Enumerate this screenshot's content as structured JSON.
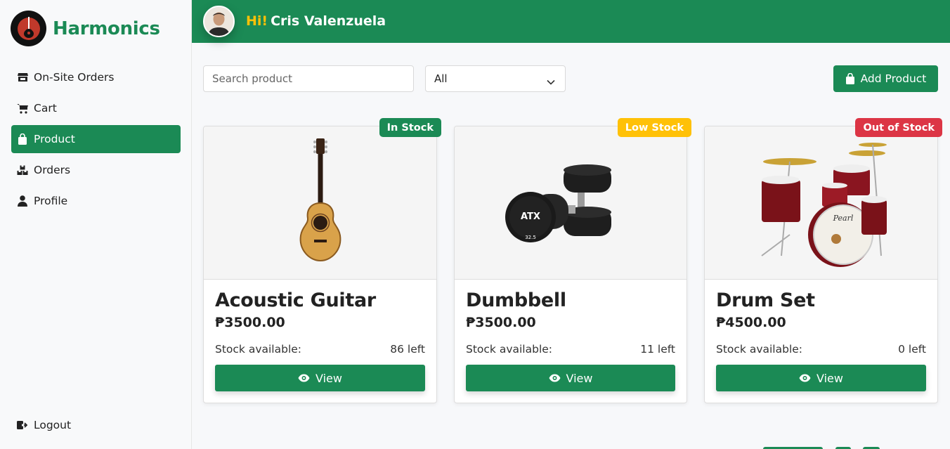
{
  "brand": {
    "name": "Harmonics",
    "logo_icon": "guitar-logo-icon"
  },
  "sidebar": {
    "items": [
      {
        "label": "On-Site Orders",
        "icon": "store-icon",
        "active": false
      },
      {
        "label": "Cart",
        "icon": "cart-icon",
        "active": false
      },
      {
        "label": "Product",
        "icon": "shopping-bag-icon",
        "active": true
      },
      {
        "label": "Orders",
        "icon": "boxes-icon",
        "active": false
      },
      {
        "label": "Profile",
        "icon": "user-icon",
        "active": false
      }
    ],
    "logout_label": "Logout"
  },
  "header": {
    "hi": "Hi!",
    "user_name": "Cris Valenzuela"
  },
  "toolbar": {
    "search_placeholder": "Search product",
    "filter_value": "All",
    "add_label": "Add Product"
  },
  "products": [
    {
      "name": "Acoustic Guitar",
      "price": "₱3500.00",
      "stock_label": "Stock available:",
      "stock": "86 left",
      "badge": "In Stock",
      "badge_color": "#1b8a55",
      "badge_text_color": "#ffffff",
      "view_label": "View"
    },
    {
      "name": "Dumbbell",
      "price": "₱3500.00",
      "stock_label": "Stock available:",
      "stock": "11 left",
      "badge": "Low Stock",
      "badge_color": "#ffc107",
      "badge_text_color": "#ffffff",
      "view_label": "View"
    },
    {
      "name": "Drum Set",
      "price": "₱4500.00",
      "stock_label": "Stock available:",
      "stock": "0 left",
      "badge": "Out of Stock",
      "badge_color": "#dc3545",
      "badge_text_color": "#ffffff",
      "view_label": "View"
    }
  ],
  "colors": {
    "primary": "#1b8a55",
    "warning": "#ffc107",
    "danger": "#dc3545"
  }
}
